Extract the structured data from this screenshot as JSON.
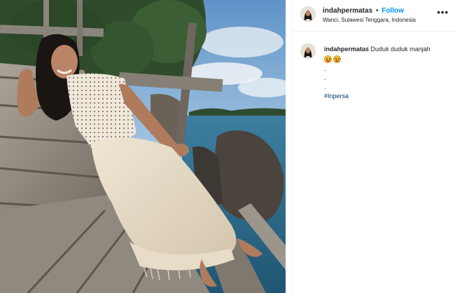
{
  "post": {
    "username": "indahpermatas",
    "separator": "•",
    "follow_label": "Follow",
    "location": "Wanci, Sulawesi Tenggara, Indonesia",
    "more_label": "•••",
    "caption": {
      "username": "indahpermatas",
      "text": "Duduk duduk manjah",
      "emojis": [
        "grinning-face-emoji",
        "grinning-face-emoji"
      ],
      "dot_lines": [
        ".",
        ".",
        "."
      ],
      "hashtag": "#Inpersa"
    }
  },
  "photo": {
    "description_icon": "photo-woman-on-boardwalk"
  },
  "colors": {
    "follow": "#0095f6",
    "hashtag": "#00376b",
    "divider": "#efefef"
  }
}
